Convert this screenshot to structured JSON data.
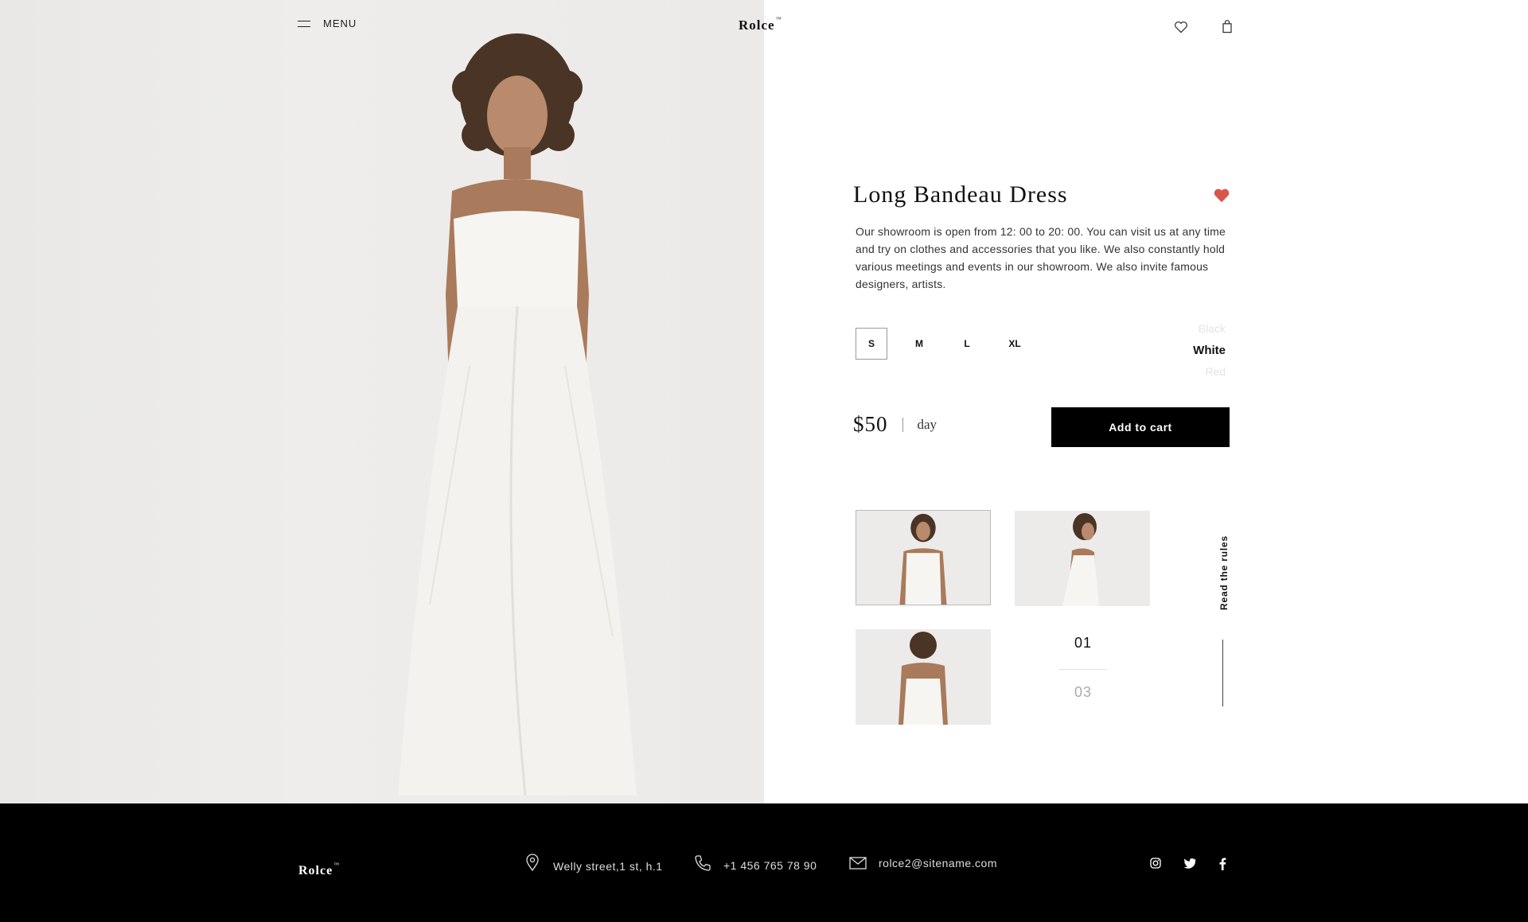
{
  "header": {
    "menu_label": "MENU",
    "logo_text": "Rolce",
    "logo_mark": "™",
    "icons": [
      "heart-icon",
      "shopping-bag-icon"
    ]
  },
  "product": {
    "title": "Long Bandeau Dress",
    "favorited": true,
    "description": "Our showroom is open from 12: 00 to 20: 00. You can visit us at any time and try on clothes and accessories that you like. We also constantly hold various meetings and events in our showroom. We also invite famous designers, artists.",
    "sizes": [
      "S",
      "M",
      "L",
      "XL"
    ],
    "selected_size": "S",
    "colors": [
      "Black",
      "White",
      "Red"
    ],
    "selected_color": "White",
    "price": "$50",
    "price_unit": "day",
    "add_to_cart": "Add to cart",
    "accent_color": "#d9564a"
  },
  "gallery": {
    "current_page": "01",
    "total_pages": "03",
    "read_rules": "Read the rules"
  },
  "footer": {
    "logo_text": "Rolce",
    "logo_mark": "™",
    "address": "Welly street,1 st, h.1",
    "phone": "+1 456 765 78 90",
    "email": "rolce2@sitename.com",
    "socials": [
      "instagram-icon",
      "twitter-icon",
      "facebook-icon"
    ]
  }
}
